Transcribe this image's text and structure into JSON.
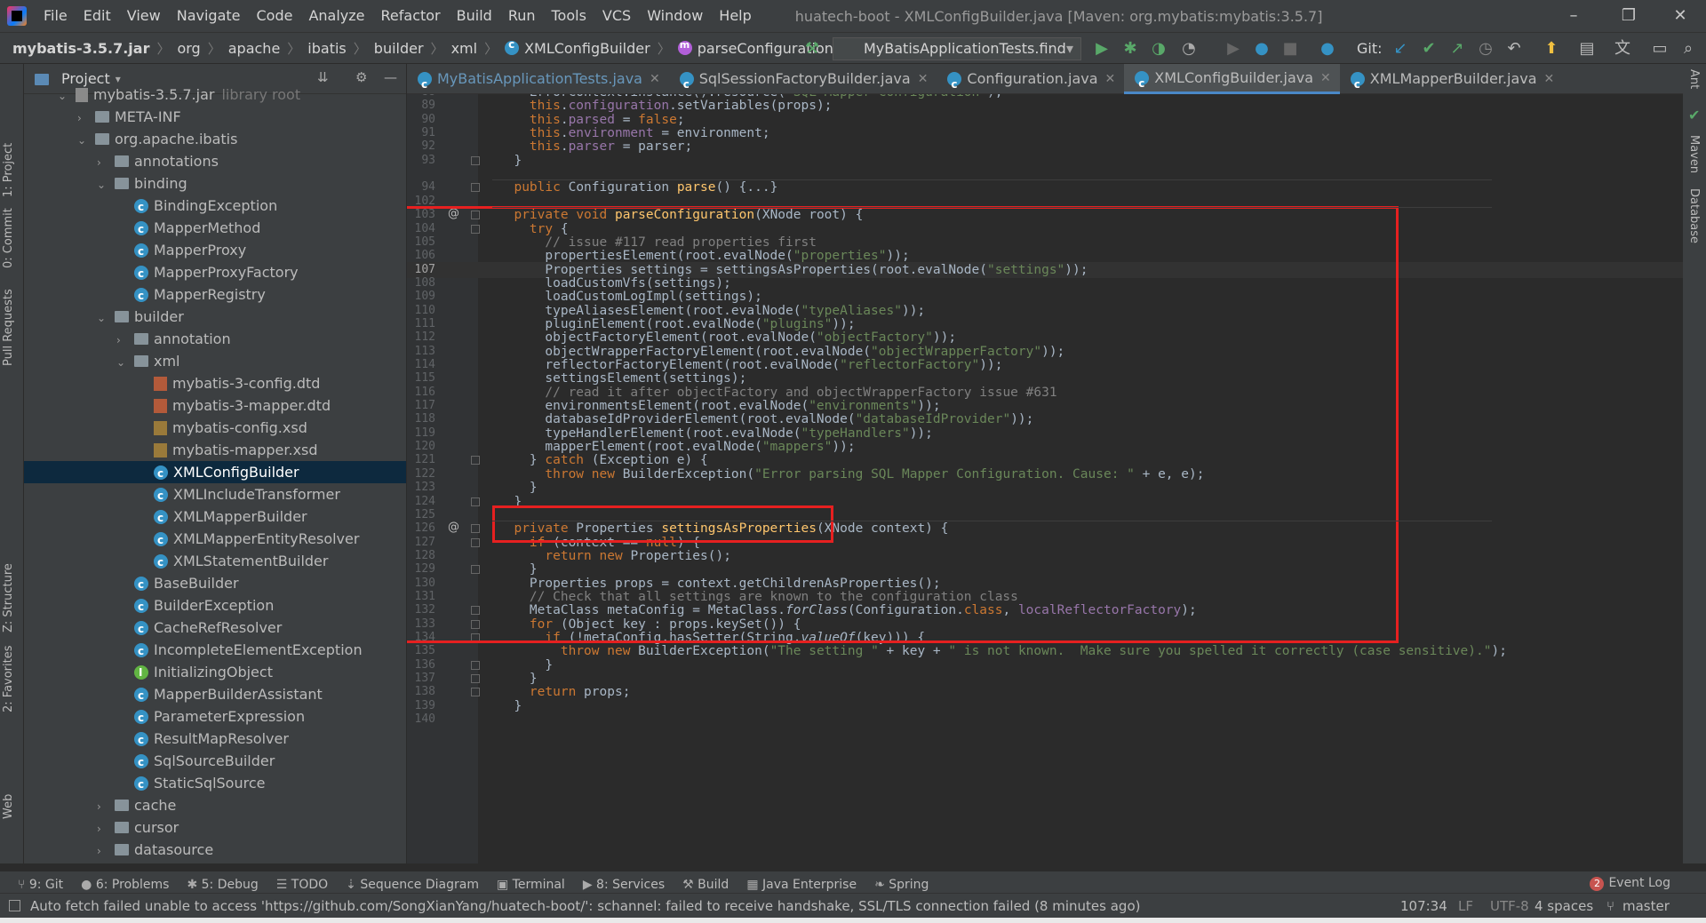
{
  "menubar": {
    "items": [
      "File",
      "Edit",
      "View",
      "Navigate",
      "Code",
      "Analyze",
      "Refactor",
      "Build",
      "Run",
      "Tools",
      "VCS",
      "Window",
      "Help"
    ],
    "window_title": "huatech-boot - XMLConfigBuilder.java [Maven: org.mybatis:mybatis:3.5.7]"
  },
  "navbar": {
    "crumbs": [
      "mybatis-3.5.7.jar",
      "org",
      "apache",
      "ibatis",
      "builder",
      "xml",
      "XMLConfigBuilder",
      "parseConfiguration"
    ],
    "run_config": "MyBatisApplicationTests.find",
    "git_label": "Git:"
  },
  "project_panel": {
    "title": "Project",
    "tree": [
      {
        "label": "mybatis-3.5.7.jar",
        "suffix": "library root",
        "depth": 0,
        "type": "jar",
        "expanded": true
      },
      {
        "label": "META-INF",
        "depth": 1,
        "type": "folder",
        "expanded": false
      },
      {
        "label": "org.apache.ibatis",
        "depth": 1,
        "type": "folder",
        "expanded": true
      },
      {
        "label": "annotations",
        "depth": 2,
        "type": "folder",
        "expanded": false
      },
      {
        "label": "binding",
        "depth": 2,
        "type": "folder",
        "expanded": true
      },
      {
        "label": "BindingException",
        "depth": 3,
        "type": "class"
      },
      {
        "label": "MapperMethod",
        "depth": 3,
        "type": "class"
      },
      {
        "label": "MapperProxy",
        "depth": 3,
        "type": "class"
      },
      {
        "label": "MapperProxyFactory",
        "depth": 3,
        "type": "class"
      },
      {
        "label": "MapperRegistry",
        "depth": 3,
        "type": "class"
      },
      {
        "label": "builder",
        "depth": 2,
        "type": "folder",
        "expanded": true
      },
      {
        "label": "annotation",
        "depth": 3,
        "type": "folder",
        "expanded": false
      },
      {
        "label": "xml",
        "depth": 3,
        "type": "folder",
        "expanded": true
      },
      {
        "label": "mybatis-3-config.dtd",
        "depth": 4,
        "type": "dtd"
      },
      {
        "label": "mybatis-3-mapper.dtd",
        "depth": 4,
        "type": "dtd"
      },
      {
        "label": "mybatis-config.xsd",
        "depth": 4,
        "type": "xsd"
      },
      {
        "label": "mybatis-mapper.xsd",
        "depth": 4,
        "type": "xsd"
      },
      {
        "label": "XMLConfigBuilder",
        "depth": 4,
        "type": "class",
        "selected": true
      },
      {
        "label": "XMLIncludeTransformer",
        "depth": 4,
        "type": "class"
      },
      {
        "label": "XMLMapperBuilder",
        "depth": 4,
        "type": "class"
      },
      {
        "label": "XMLMapperEntityResolver",
        "depth": 4,
        "type": "class"
      },
      {
        "label": "XMLStatementBuilder",
        "depth": 4,
        "type": "class"
      },
      {
        "label": "BaseBuilder",
        "depth": 3,
        "type": "class"
      },
      {
        "label": "BuilderException",
        "depth": 3,
        "type": "class"
      },
      {
        "label": "CacheRefResolver",
        "depth": 3,
        "type": "class"
      },
      {
        "label": "IncompleteElementException",
        "depth": 3,
        "type": "class"
      },
      {
        "label": "InitializingObject",
        "depth": 3,
        "type": "interface"
      },
      {
        "label": "MapperBuilderAssistant",
        "depth": 3,
        "type": "class"
      },
      {
        "label": "ParameterExpression",
        "depth": 3,
        "type": "class"
      },
      {
        "label": "ResultMapResolver",
        "depth": 3,
        "type": "class"
      },
      {
        "label": "SqlSourceBuilder",
        "depth": 3,
        "type": "class"
      },
      {
        "label": "StaticSqlSource",
        "depth": 3,
        "type": "class"
      },
      {
        "label": "cache",
        "depth": 2,
        "type": "folder",
        "expanded": false
      },
      {
        "label": "cursor",
        "depth": 2,
        "type": "folder",
        "expanded": false
      },
      {
        "label": "datasource",
        "depth": 2,
        "type": "folder",
        "expanded": false
      }
    ]
  },
  "left_stripe": [
    "1: Project",
    "0: Commit",
    "Pull Requests",
    "Z: Structure",
    "2: Favorites",
    "Web"
  ],
  "right_stripe": [
    "Ant",
    "Maven",
    "Database"
  ],
  "editor_tabs": [
    {
      "label": "MyBatisApplicationTests.java",
      "active": false,
      "linked": true
    },
    {
      "label": "SqlSessionFactoryBuilder.java",
      "active": false
    },
    {
      "label": "Configuration.java",
      "active": false
    },
    {
      "label": "XMLConfigBuilder.java",
      "active": true
    },
    {
      "label": "XMLMapperBuilder.java",
      "active": false
    }
  ],
  "editor": {
    "current_line": 107,
    "lines": [
      {
        "n": 88,
        "t": "    ErrorContext.instance().resource(\"SQL Mapper Configuration\");"
      },
      {
        "n": 89,
        "t": "    this.configuration.setVariables(props);"
      },
      {
        "n": 90,
        "t": "    this.parsed = false;"
      },
      {
        "n": 91,
        "t": "    this.environment = environment;"
      },
      {
        "n": 92,
        "t": "    this.parser = parser;"
      },
      {
        "n": 93,
        "t": "  }"
      },
      {
        "n": 94,
        "t": ""
      },
      {
        "n": 94,
        "t": "  public Configuration parse() {...}"
      },
      {
        "n": 102,
        "t": ""
      },
      {
        "n": 103,
        "t": "  private void parseConfiguration(XNode root) {"
      },
      {
        "n": 104,
        "t": "    try {"
      },
      {
        "n": 105,
        "t": "      // issue #117 read properties first"
      },
      {
        "n": 106,
        "t": "      propertiesElement(root.evalNode(\"properties\"));"
      },
      {
        "n": 107,
        "t": "      Properties settings = settingsAsProperties(root.evalNode(\"settings\"));"
      },
      {
        "n": 108,
        "t": "      loadCustomVfs(settings);"
      },
      {
        "n": 109,
        "t": "      loadCustomLogImpl(settings);"
      },
      {
        "n": 110,
        "t": "      typeAliasesElement(root.evalNode(\"typeAliases\"));"
      },
      {
        "n": 111,
        "t": "      pluginElement(root.evalNode(\"plugins\"));"
      },
      {
        "n": 112,
        "t": "      objectFactoryElement(root.evalNode(\"objectFactory\"));"
      },
      {
        "n": 113,
        "t": "      objectWrapperFactoryElement(root.evalNode(\"objectWrapperFactory\"));"
      },
      {
        "n": 114,
        "t": "      reflectorFactoryElement(root.evalNode(\"reflectorFactory\"));"
      },
      {
        "n": 115,
        "t": "      settingsElement(settings);"
      },
      {
        "n": 116,
        "t": "      // read it after objectFactory and objectWrapperFactory issue #631"
      },
      {
        "n": 117,
        "t": "      environmentsElement(root.evalNode(\"environments\"));"
      },
      {
        "n": 118,
        "t": "      databaseIdProviderElement(root.evalNode(\"databaseIdProvider\"));"
      },
      {
        "n": 119,
        "t": "      typeHandlerElement(root.evalNode(\"typeHandlers\"));"
      },
      {
        "n": 120,
        "t": "      mapperElement(root.evalNode(\"mappers\"));"
      },
      {
        "n": 121,
        "t": "    } catch (Exception e) {"
      },
      {
        "n": 122,
        "t": "      throw new BuilderException(\"Error parsing SQL Mapper Configuration. Cause: \" + e, e);"
      },
      {
        "n": 123,
        "t": "    }"
      },
      {
        "n": 124,
        "t": "  }"
      },
      {
        "n": 125,
        "t": ""
      },
      {
        "n": 126,
        "t": "  private Properties settingsAsProperties(XNode context) {"
      },
      {
        "n": 127,
        "t": "    if (context == null) {"
      },
      {
        "n": 128,
        "t": "      return new Properties();"
      },
      {
        "n": 129,
        "t": "    }"
      },
      {
        "n": 130,
        "t": "    Properties props = context.getChildrenAsProperties();"
      },
      {
        "n": 131,
        "t": "    // Check that all settings are known to the configuration class"
      },
      {
        "n": 132,
        "t": "    MetaClass metaConfig = MetaClass.forClass(Configuration.class, localReflectorFactory);"
      },
      {
        "n": 133,
        "t": "    for (Object key : props.keySet()) {"
      },
      {
        "n": 134,
        "t": "      if (!metaConfig.hasSetter(String.valueOf(key))) {"
      },
      {
        "n": 135,
        "t": "        throw new BuilderException(\"The setting \" + key + \" is not known.  Make sure you spelled it correctly (case sensitive).\");"
      },
      {
        "n": 136,
        "t": "      }"
      },
      {
        "n": 137,
        "t": "    }"
      },
      {
        "n": 138,
        "t": "    return props;"
      },
      {
        "n": 139,
        "t": "  }"
      },
      {
        "n": 140,
        "t": ""
      }
    ]
  },
  "bottom_tools": [
    "9: Git",
    "6: Problems",
    "5: Debug",
    "TODO",
    "Sequence Diagram",
    "Terminal",
    "8: Services",
    "Build",
    "Java Enterprise",
    "Spring"
  ],
  "event_log": {
    "label": "Event Log",
    "count": "2"
  },
  "statusbar": {
    "message": "Auto fetch failed unable to access 'https://github.com/SongXianYang/huatech-boot/': schannel: failed to receive handshake, SSL/TLS connection failed (8 minutes ago)",
    "position": "107:34",
    "line_sep": "LF",
    "encoding": "UTF-8",
    "indent": "4 spaces",
    "branch": "master"
  },
  "colors": {
    "annotation_box": "#e62020",
    "selection": "#0d293e",
    "accent": "#4a88c7"
  }
}
